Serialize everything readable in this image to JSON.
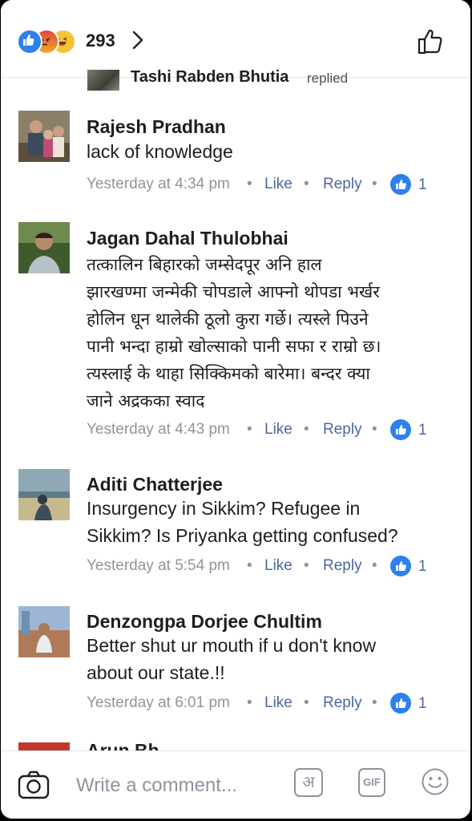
{
  "header": {
    "reaction_icons": [
      "like-reaction-icon",
      "angry-reaction-icon",
      "haha-reaction-icon"
    ],
    "reaction_count": "293"
  },
  "reply_preview": {
    "name": "Tashi Rabden Bhutia",
    "verb": "replied"
  },
  "comments": [
    {
      "name": "Rajesh Pradhan",
      "lines": [
        "lack of knowledge"
      ],
      "time": "Yesterday at 4:34 pm",
      "like_label": "Like",
      "reply_label": "Reply",
      "likes": "1"
    },
    {
      "name": "Jagan Dahal Thulobhai",
      "lines": [
        "तत्कालिन बिहारको जम्सेदपूर अनि हाल",
        "झारखण्मा जन्मेकी चोपडाले आफ्नो थोपडा भर्खर",
        "होलिन धून थालेकी ठूलो कुरा गर्छे। त्यस्ले पिउने",
        "पानी भन्दा हाम्रो खोल्साको पानी सफा र राम्रो छ।",
        "त्यस्लाई के थाहा सिक्किमको बारेमा। बन्दर क्या",
        "जाने अद्रकका स्वाद"
      ],
      "time": "Yesterday at 4:43 pm",
      "like_label": "Like",
      "reply_label": "Reply",
      "likes": "1"
    },
    {
      "name": "Aditi Chatterjee",
      "lines": [
        "Insurgency in Sikkim? Refugee in",
        "Sikkim? Is Priyanka getting confused?"
      ],
      "time": "Yesterday at 5:54 pm",
      "like_label": "Like",
      "reply_label": "Reply",
      "likes": "1"
    },
    {
      "name": "Denzongpa Dorjee Chultim",
      "lines": [
        "Better shut ur mouth if u don't know",
        "about our state.!!"
      ],
      "time": "Yesterday at 6:01 pm",
      "like_label": "Like",
      "reply_label": "Reply",
      "likes": "1"
    }
  ],
  "next_comment_name_partial": "Arun Bh",
  "composer": {
    "placeholder": "Write a comment...",
    "hindi_key": "अ",
    "gif_label": "GIF"
  },
  "colors": {
    "link": "#4b67a1",
    "meta": "#90949c",
    "like_blue": "#2f80ed"
  }
}
